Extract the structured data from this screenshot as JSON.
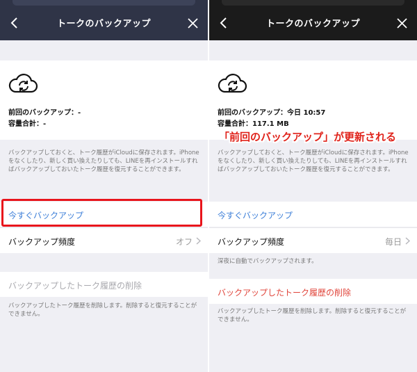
{
  "left": {
    "title": "トークのバックアップ",
    "last_backup": "前回のバックアップ：-",
    "total_size": "容量合計：-",
    "info": "バックアップしておくと、トーク履歴がiCloudに保存されます。iPhoneをなくしたり、新しく買い換えたりしても、LINEを再インストールすればバックアップしておいたトーク履歴を復元することができます。",
    "backup_now": "今すぐバックアップ",
    "frequency_label": "バックアップ頻度",
    "frequency_value": "オフ",
    "delete_label": "バックアップしたトーク履歴の削除",
    "delete_note": "バックアップしたトーク履歴を削除します。削除すると復元することができません。"
  },
  "right": {
    "title": "トークのバックアップ",
    "last_backup": "前回のバックアップ：今日 10:57",
    "total_size": "容量合計：117.1 MB",
    "info": "バックアップしておくと、トーク履歴がiCloudに保存されます。iPhoneをなくしたり、新しく買い換えたりしても、LINEを再インストールすればバックアップしておいたトーク履歴を復元することができます。",
    "backup_now": "今すぐバックアップ",
    "frequency_label": "バックアップ頻度",
    "frequency_value": "毎日",
    "auto_note": "深夜に自動でバックアップされます。",
    "delete_label": "バックアップしたトーク履歴の削除",
    "delete_note": "バックアップしたトーク履歴を削除します。削除すると復元することができません。"
  },
  "annotation": {
    "callout": "「前回のバックアップ」が更新される"
  },
  "icons": {
    "back": "chevron-left-icon",
    "close": "close-icon",
    "cloud": "cloud-sync-icon",
    "chevron": "chevron-right-icon"
  },
  "colors": {
    "link_blue": "#3d7fd8",
    "delete_red": "#e0443a",
    "highlight_red": "#e8141b",
    "nav_left": "#2f3447",
    "nav_right": "#1b1b1b"
  }
}
